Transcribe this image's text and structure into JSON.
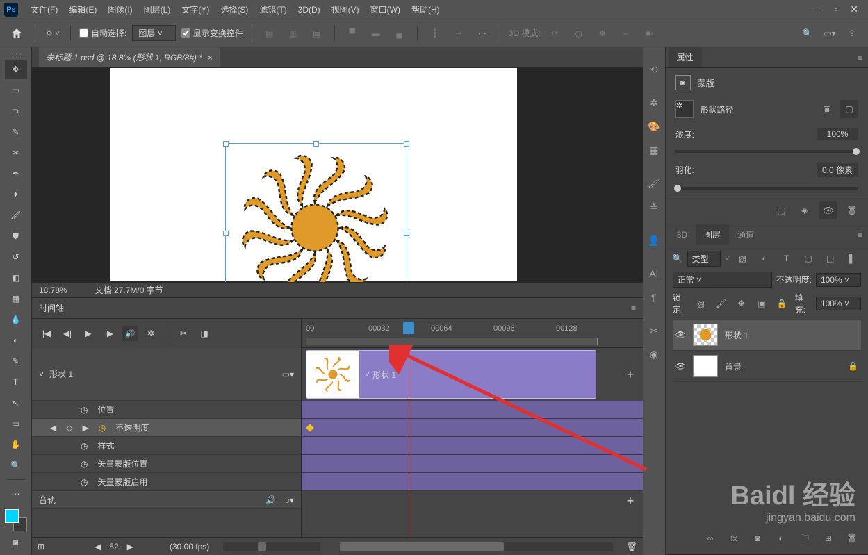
{
  "menu": {
    "items": [
      "文件(F)",
      "编辑(E)",
      "图像(I)",
      "图层(L)",
      "文字(Y)",
      "选择(S)",
      "滤镜(T)",
      "3D(D)",
      "视图(V)",
      "窗口(W)",
      "帮助(H)"
    ]
  },
  "options": {
    "auto_select": "自动选择:",
    "layer_dd": "图层",
    "show_transform": "显示变换控件",
    "mode3d": "3D 模式:"
  },
  "doc": {
    "tab": "未标题-1.psd @ 18.8% (形状 1, RGB/8#) *",
    "zoom": "18.78%",
    "docinfo": "文档:27.7M/0 字节"
  },
  "timeline": {
    "title": "时间轴",
    "layer": "形状 1",
    "clip_label": "形状 1",
    "props": [
      "位置",
      "不透明度",
      "样式",
      "矢量蒙版位置",
      "矢量蒙版启用"
    ],
    "audio": "音轨",
    "ticks": [
      "00",
      "00032",
      "00064",
      "00096",
      "00128"
    ],
    "frame": "52",
    "fps": "(30.00 fps)"
  },
  "properties": {
    "tab": "属性",
    "mask": "蒙版",
    "shape_path": "形状路径",
    "density": "浓度:",
    "density_val": "100%",
    "feather": "羽化:",
    "feather_val": "0.0 像素"
  },
  "layers_panel": {
    "tabs": [
      "3D",
      "图层",
      "通道"
    ],
    "kind": "类型",
    "blend": "正常",
    "opacity_lbl": "不透明度:",
    "opacity": "100%",
    "lock_lbl": "锁定:",
    "fill_lbl": "填充:",
    "fill": "100%",
    "layer1": "形状 1",
    "layer2": "背景"
  },
  "watermark": {
    "big": "Baidl 经验",
    "small": "jingyan.baidu.com"
  }
}
